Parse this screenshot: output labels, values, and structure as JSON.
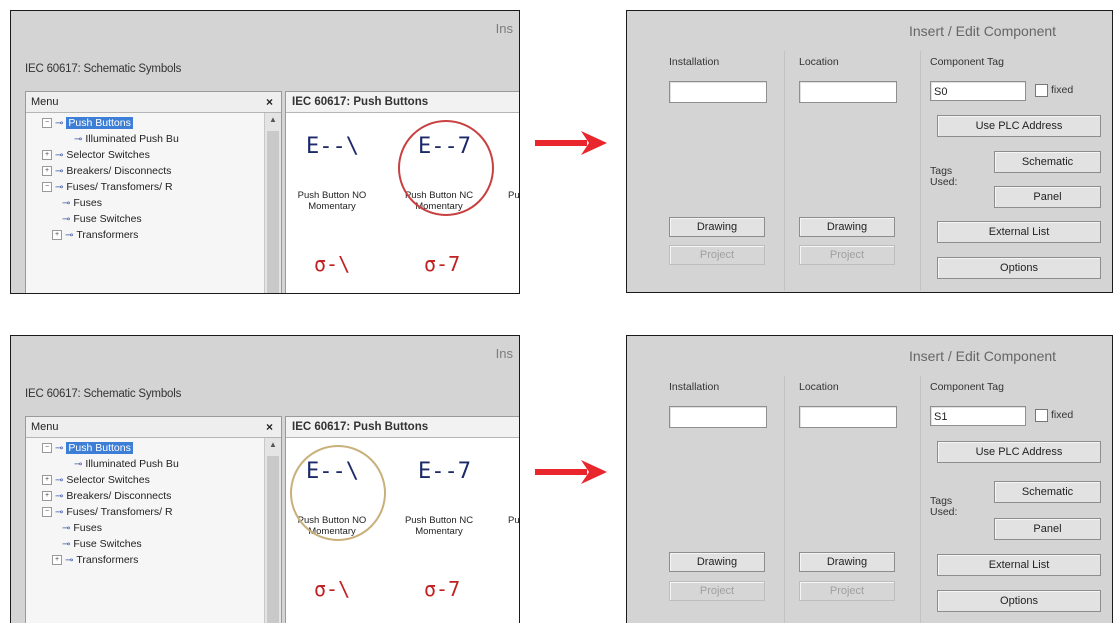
{
  "left_window": {
    "title_fragment": "Ins",
    "dialog_title": "IEC 60617: Schematic Symbols",
    "menu": {
      "header": "Menu",
      "close_label": "×",
      "tree": [
        {
          "label": "Push Buttons",
          "selected": true
        },
        {
          "label": "Illuminated Push Bu",
          "selected": false
        },
        {
          "label": "Selector Switches",
          "selected": false
        },
        {
          "label": "Breakers/ Disconnects",
          "selected": false
        },
        {
          "label": "Fuses/ Transfomers/ R",
          "selected": false
        },
        {
          "label": "Fuses",
          "selected": false
        },
        {
          "label": "Fuse Switches",
          "selected": false
        },
        {
          "label": "Transformers",
          "selected": false
        }
      ]
    },
    "symbols": {
      "header": "IEC 60617: Push Buttons",
      "items": [
        {
          "glyph": "E--\\",
          "label_line1": "Push Button NO",
          "label_line2": "Momentary"
        },
        {
          "glyph": "E--7",
          "label_line1": "Push Button NC",
          "label_line2": "Momentary"
        }
      ],
      "partial_label": "Pu",
      "second_row": [
        "σ-\\",
        "σ-7"
      ]
    }
  },
  "right_window": {
    "title": "Insert / Edit Component",
    "installation_label": "Installation",
    "location_label": "Location",
    "component_tag_label": "Component Tag",
    "fixed_label": "fixed",
    "use_plc_label": "Use PLC Address",
    "tags_used_label": "Tags Used:",
    "schematic_label": "Schematic",
    "panel_label": "Panel",
    "drawing_label": "Drawing",
    "project_label": "Project",
    "external_list_label": "External List",
    "options_label": "Options"
  },
  "steps": [
    {
      "component_tag_value": "S0",
      "highlighted_symbol": "Push Button NC Momentary"
    },
    {
      "component_tag_value": "S1",
      "highlighted_symbol": "Push Button NO Momentary"
    }
  ],
  "colors": {
    "arrow": "#e8262b",
    "selection": "#3d7fd6",
    "highlight_circle_1": "#c84040",
    "highlight_circle_2": "#c9b07a"
  }
}
